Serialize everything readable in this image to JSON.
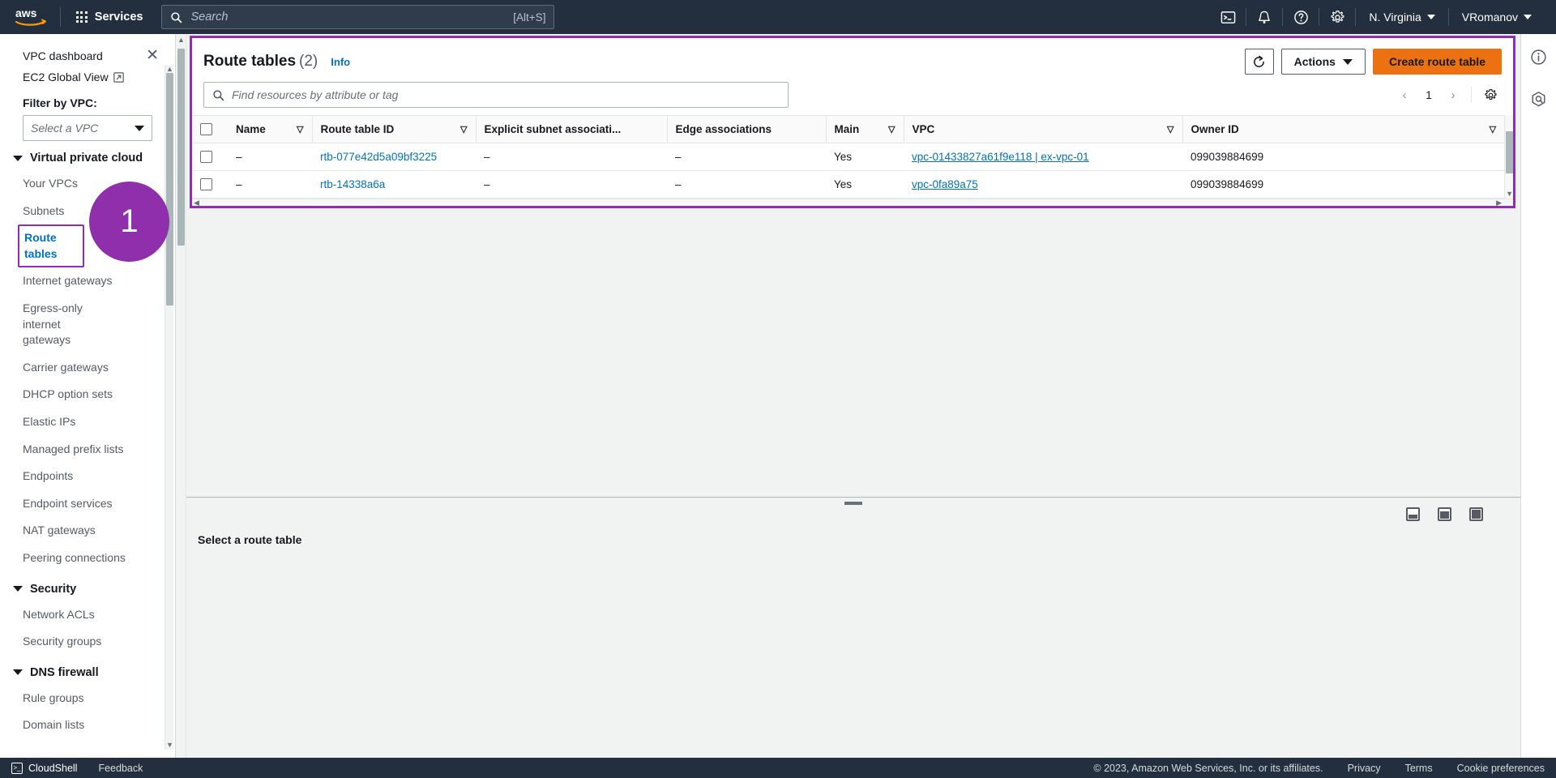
{
  "topnav": {
    "logo": "aws-logo",
    "services_label": "Services",
    "search_placeholder": "Search",
    "search_value": "",
    "search_shortcut": "[Alt+S]",
    "cloudshell_icon": "cloudshell-icon",
    "notifications_icon": "bell-icon",
    "help_icon": "help-circle-icon",
    "settings_icon": "gear-icon",
    "region": "N. Virginia",
    "account": "VRomanov"
  },
  "sidebar": {
    "dashboard_label": "VPC dashboard",
    "close_icon": "close-icon",
    "global_view_label": "EC2 Global View",
    "external_link_icon": "external-link-icon",
    "filter_label": "Filter by VPC:",
    "vpc_select_placeholder": "Select a VPC",
    "groups": [
      {
        "title": "Virtual private cloud",
        "items": [
          "Your VPCs",
          "Subnets",
          "Route tables",
          "Internet gateways",
          "Egress-only internet gateways",
          "Carrier gateways",
          "DHCP option sets",
          "Elastic IPs",
          "Managed prefix lists",
          "Endpoints",
          "Endpoint services",
          "NAT gateways",
          "Peering connections"
        ]
      },
      {
        "title": "Security",
        "items": [
          "Network ACLs",
          "Security groups"
        ]
      },
      {
        "title": "DNS firewall",
        "items": [
          "Rule groups",
          "Domain lists"
        ]
      }
    ],
    "active_item": "Route tables"
  },
  "annotation": {
    "step_number": "1",
    "color": "#8f2fab"
  },
  "header": {
    "title": "Route tables",
    "count": "(2)",
    "info_label": "Info",
    "refresh_icon": "refresh-icon",
    "actions_label": "Actions",
    "create_label": "Create route table"
  },
  "search": {
    "icon": "search-icon",
    "placeholder": "Find resources by attribute or tag",
    "value": ""
  },
  "pagination": {
    "prev_icon": "chevron-left-icon",
    "page": "1",
    "next_icon": "chevron-right-icon",
    "settings_icon": "gear-icon"
  },
  "table": {
    "columns": [
      "Name",
      "Route table ID",
      "Explicit subnet associati...",
      "Edge associations",
      "Main",
      "VPC",
      "Owner ID"
    ],
    "sortable": [
      true,
      true,
      false,
      false,
      true,
      true,
      true
    ],
    "rows": [
      {
        "name": "–",
        "route_table_id": "rtb-077e42d5a09bf3225",
        "explicit_subnet": "–",
        "edge_associations": "–",
        "main": "Yes",
        "vpc": "vpc-01433827a61f9e118 | ex-vpc-01",
        "owner_id": "099039884699"
      },
      {
        "name": "–",
        "route_table_id": "rtb-14338a6a",
        "explicit_subnet": "–",
        "edge_associations": "–",
        "main": "Yes",
        "vpc": "vpc-0fa89a75",
        "owner_id": "099039884699"
      }
    ]
  },
  "split_panel": {
    "title": "Select a route table",
    "layout_icons": [
      "panel-bottom-icon",
      "panel-split-icon",
      "panel-full-icon"
    ]
  },
  "right_rail": {
    "icons": [
      "info-icon",
      "assistant-icon"
    ]
  },
  "footer": {
    "cloudshell_label": "CloudShell",
    "feedback_label": "Feedback",
    "copyright": "© 2023, Amazon Web Services, Inc. or its affiliates.",
    "privacy": "Privacy",
    "terms": "Terms",
    "cookie": "Cookie preferences"
  }
}
